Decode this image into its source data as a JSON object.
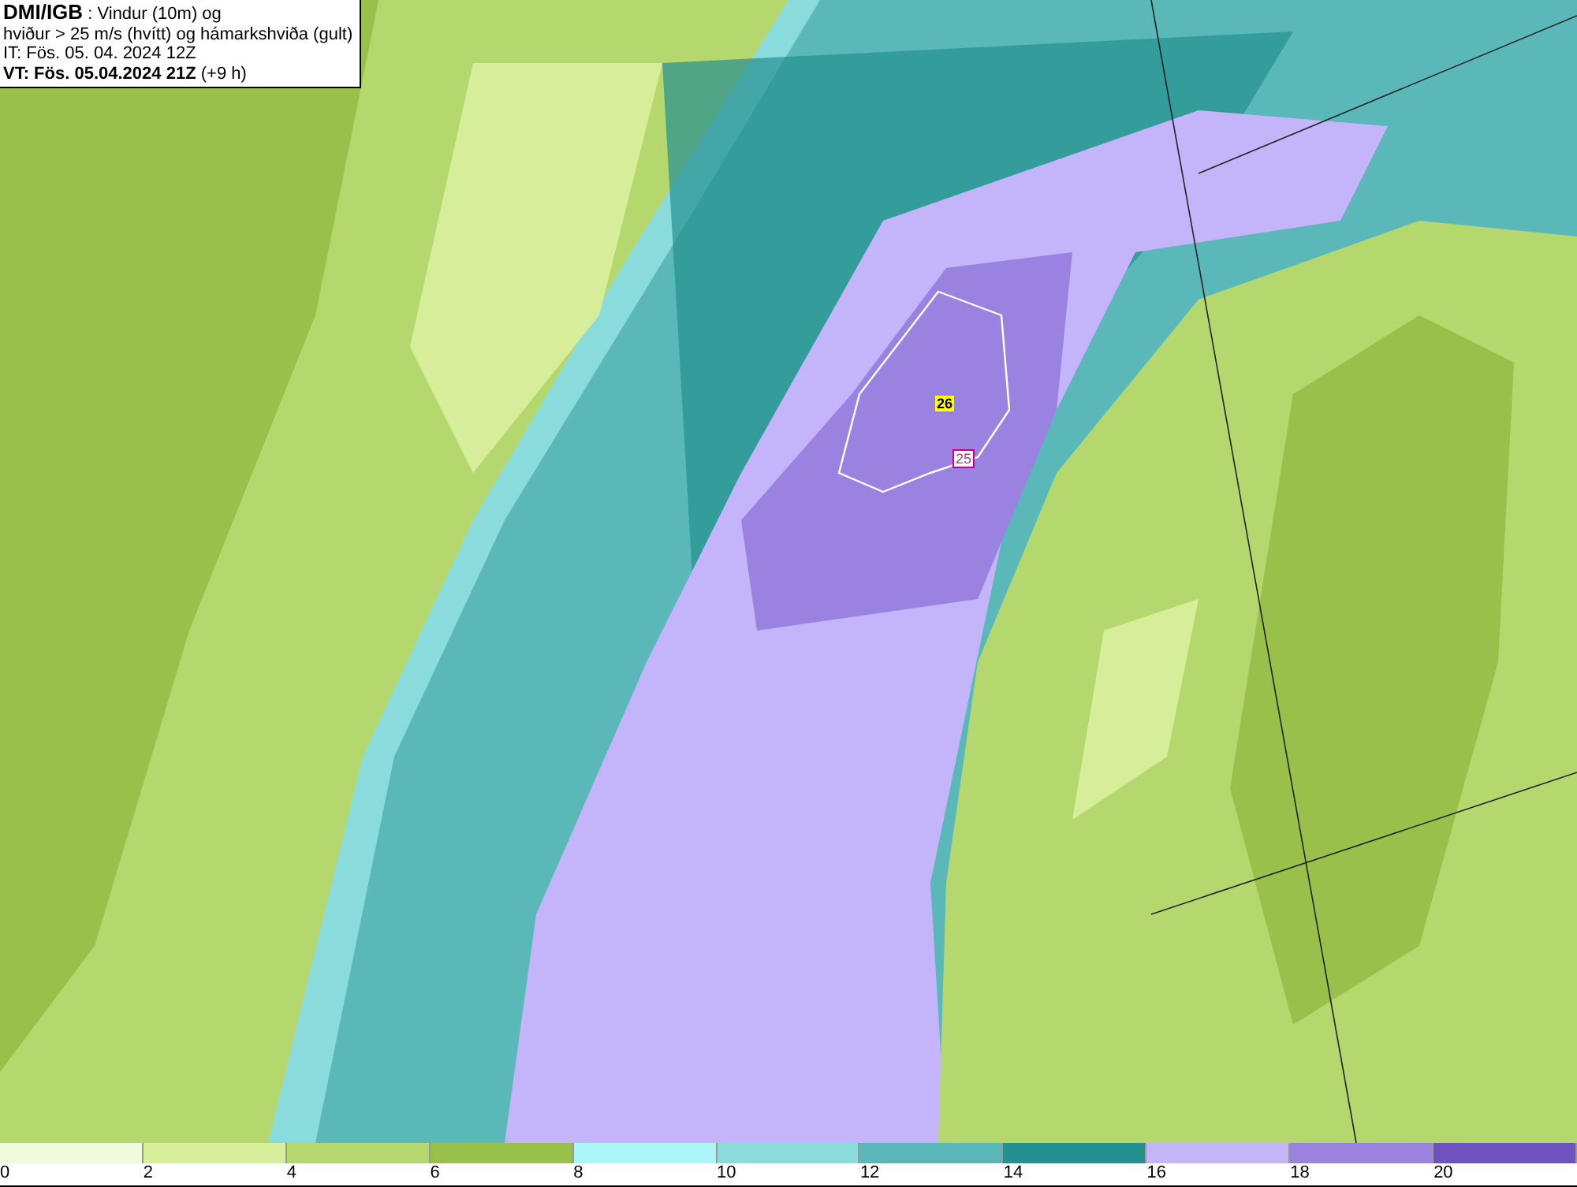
{
  "header": {
    "source": "DMI/IGB",
    "title": ": Vindur (10m) og",
    "subtitle": "hviður > 25 m/s (hvítt) og hámarkshviða (gult)",
    "initial_time": "IT: Fös. 05. 04. 2024 12Z",
    "valid_time": "VT: Fös. 05.04.2024 21Z",
    "lead": "(+9 h)"
  },
  "map": {
    "labels": [
      {
        "text": "26",
        "kind": "max"
      },
      {
        "text": "25",
        "kind": "contour"
      }
    ]
  },
  "legend": [
    {
      "label": "0",
      "color": "#f0fadc"
    },
    {
      "label": "2",
      "color": "#d6ee9a"
    },
    {
      "label": "4",
      "color": "#b5d86e"
    },
    {
      "label": "6",
      "color": "#99c04a"
    },
    {
      "label": "8",
      "color": "#aaf6f8"
    },
    {
      "label": "10",
      "color": "#8adcdc"
    },
    {
      "label": "12",
      "color": "#5ab8b8"
    },
    {
      "label": "14",
      "color": "#259090"
    },
    {
      "label": "16",
      "color": "#c4b4fa"
    },
    {
      "label": "18",
      "color": "#9a82e0"
    },
    {
      "label": "20",
      "color": "#6e52c0"
    }
  ]
}
